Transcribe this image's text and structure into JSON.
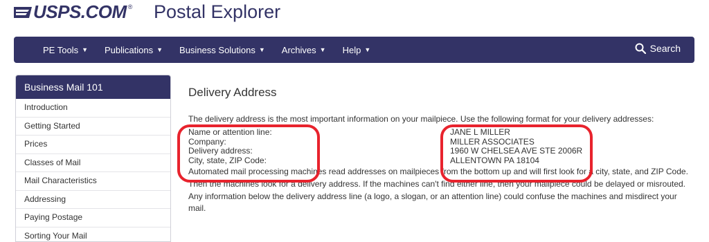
{
  "header": {
    "logo_text": "USPS.COM",
    "logo_reg": "®",
    "site_title": "Postal Explorer"
  },
  "nav": {
    "items": [
      {
        "label": "PE Tools"
      },
      {
        "label": "Publications"
      },
      {
        "label": "Business Solutions"
      },
      {
        "label": "Archives"
      },
      {
        "label": "Help"
      }
    ],
    "search_label": "Search"
  },
  "sidebar": {
    "title": "Business Mail 101",
    "items": [
      {
        "label": "Introduction"
      },
      {
        "label": "Getting Started"
      },
      {
        "label": "Prices"
      },
      {
        "label": "Classes of Mail"
      },
      {
        "label": "Mail Characteristics"
      },
      {
        "label": "Addressing"
      },
      {
        "label": "Paying Postage"
      },
      {
        "label": "Sorting Your Mail"
      }
    ]
  },
  "main": {
    "heading": "Delivery Address",
    "intro": "The delivery address is the most important information on your mailpiece. Use the following format for your delivery addresses:",
    "address_rows": [
      {
        "label": "Name or attention line:",
        "value": "JANE L MILLER"
      },
      {
        "label": "Company:",
        "value": "MILLER ASSOCIATES"
      },
      {
        "label": "Delivery address:",
        "value": "1960 W CHELSEA AVE STE 2006R"
      },
      {
        "label": "City, state, ZIP Code:",
        "value": "ALLENTOWN PA 18104"
      }
    ],
    "paragraph": "Automated mail processing machines read addresses on mailpieces from the bottom up and will first look for a city, state, and ZIP Code. Then the machines look for a delivery address. If the machines can't find either line, then your mailpiece could be delayed or misrouted. Any information below the delivery address line (a logo, a slogan, or an attention line) could confuse the machines and misdirect your mail."
  },
  "colors": {
    "brand_navy": "#333366",
    "highlight_red": "#e8232d"
  }
}
